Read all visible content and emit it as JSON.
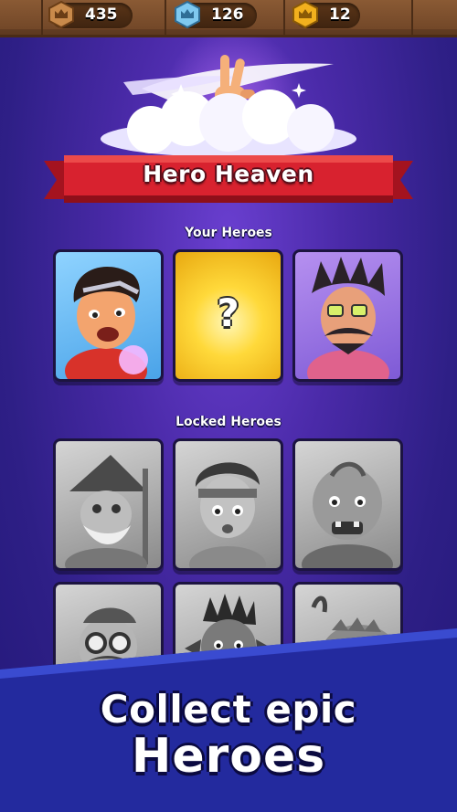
{
  "resources": [
    {
      "icon": "crown-bronze-icon",
      "value": "435",
      "color": "#c98a4b"
    },
    {
      "icon": "crown-diamond-icon",
      "value": "126",
      "color": "#7fc9f0"
    },
    {
      "icon": "crown-gold-icon",
      "value": "12",
      "color": "#f2b01e"
    }
  ],
  "banner": {
    "title": "Hero Heaven",
    "color": "#d8222f"
  },
  "your_heroes": {
    "title": "Your Heroes",
    "cards": [
      {
        "name": "red-haired-hero",
        "background": "blue"
      },
      {
        "name": "mystery-hero",
        "label": "?",
        "background": "gold"
      },
      {
        "name": "mustache-wizard-hero",
        "background": "purple"
      }
    ]
  },
  "locked_heroes": {
    "title": "Locked Heroes",
    "cards": [
      {
        "name": "old-wizard-hero"
      },
      {
        "name": "headband-fighter-hero"
      },
      {
        "name": "ogre-hero"
      },
      {
        "name": "goggles-hero"
      },
      {
        "name": "dark-warrior-hero"
      },
      {
        "name": "beast-hero"
      }
    ]
  },
  "promo": {
    "line1": "Collect epic",
    "line2": "Heroes"
  }
}
